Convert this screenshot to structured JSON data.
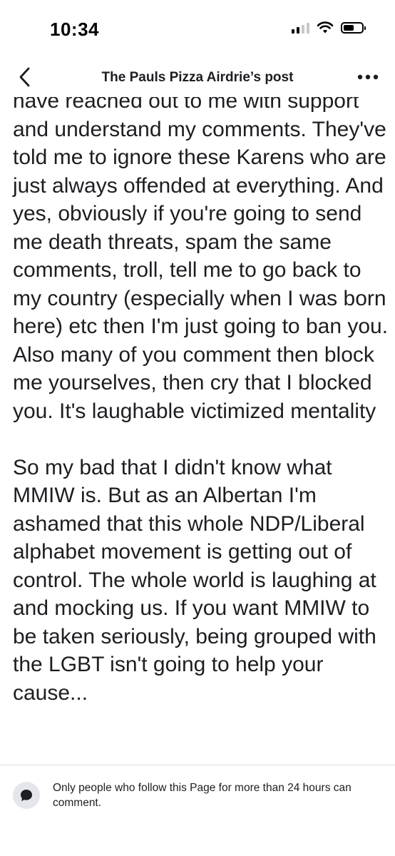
{
  "status_bar": {
    "time": "10:34",
    "icons": [
      "cellular-signal-icon",
      "wifi-icon",
      "battery-icon"
    ]
  },
  "header": {
    "back_icon": "chevron-left-icon",
    "title": "The Pauls Pizza Airdrie’s post",
    "more_icon": "more-horizontal-icon"
  },
  "post": {
    "paragraphs": [
      "have reached out to me with support and understand my comments. They've told me to ignore these Karens who are just always offended at everything. And yes, obviously if you're going to send me death threats, spam the same comments, troll, tell me to go back to my country (especially when I was born here) etc then I'm just going to ban you. Also many of you comment then block me yourselves, then cry that I blocked you. It's laughable victimized mentality",
      "So my bad that I didn't know what MMIW is. But as an Albertan I'm ashamed that this whole NDP/Liberal alphabet movement is getting out of control. The whole world is laughing at and mocking us. If you want MMIW to be taken seriously, being grouped with the LGBT isn't going to help your cause..."
    ]
  },
  "comment_notice": {
    "icon": "chat-bubble-icon",
    "text": "Only people who follow this Page for more than 24 hours can comment."
  },
  "colors": {
    "text": "#1c1e21",
    "divider": "#dadde1",
    "icon_bg": "#e4e6eb"
  }
}
